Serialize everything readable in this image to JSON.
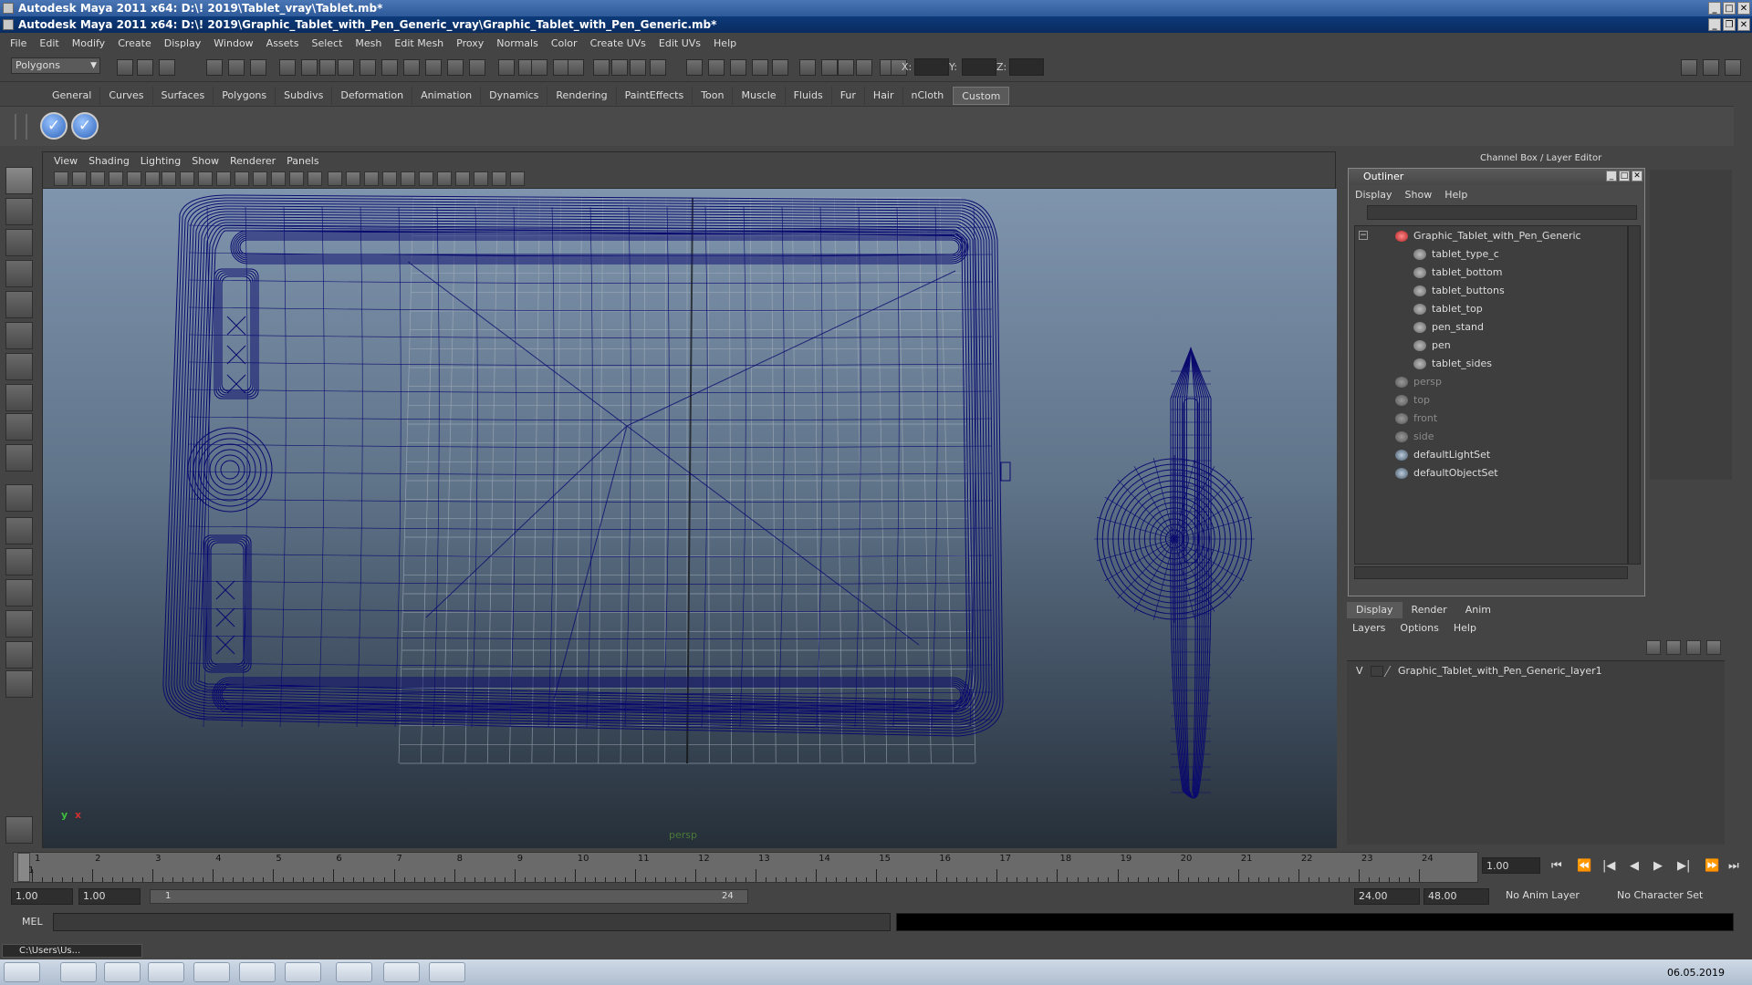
{
  "window": {
    "outer_title": "Autodesk Maya 2011 x64: D:\\! 2019\\Tablet_vray\\Tablet.mb*",
    "inner_title": "Autodesk Maya 2011 x64: D:\\! 2019\\Graphic_Tablet_with_Pen_Generic_vray\\Graphic_Tablet_with_Pen_Generic.mb*"
  },
  "menubar": [
    "File",
    "Edit",
    "Modify",
    "Create",
    "Display",
    "Window",
    "Assets",
    "Select",
    "Mesh",
    "Edit Mesh",
    "Proxy",
    "Normals",
    "Color",
    "Create UVs",
    "Edit UVs",
    "Help"
  ],
  "toolbar": {
    "mode": "Polygons",
    "x_label": "X:",
    "y_label": "Y:",
    "z_label": "Z:"
  },
  "shelf_tabs": [
    "General",
    "Curves",
    "Surfaces",
    "Polygons",
    "Subdivs",
    "Deformation",
    "Animation",
    "Dynamics",
    "Rendering",
    "PaintEffects",
    "Toon",
    "Muscle",
    "Fluids",
    "Fur",
    "Hair",
    "nCloth",
    "Custom"
  ],
  "shelf_active": "Custom",
  "viewport": {
    "menu": [
      "View",
      "Shading",
      "Lighting",
      "Show",
      "Renderer",
      "Panels"
    ],
    "camera": "persp",
    "axis_y": "y",
    "axis_x": "x",
    "wire_color": "#0a0a6e"
  },
  "right_panel": {
    "title": "Channel Box / Layer Editor"
  },
  "outliner": {
    "title": "Outliner",
    "menu": [
      "Display",
      "Show",
      "Help"
    ],
    "root": "Graphic_Tablet_with_Pen_Generic",
    "children": [
      "tablet_type_c",
      "tablet_bottom",
      "tablet_buttons",
      "tablet_top",
      "pen_stand",
      "pen",
      "tablet_sides"
    ],
    "cameras": [
      "persp",
      "top",
      "front",
      "side"
    ],
    "sets": [
      "defaultLightSet",
      "defaultObjectSet"
    ]
  },
  "layer_editor": {
    "tabs": [
      "Display",
      "Render",
      "Anim"
    ],
    "menu": [
      "Layers",
      "Options",
      "Help"
    ],
    "visibility": "V",
    "layer_name": "Graphic_Tablet_with_Pen_Generic_layer1"
  },
  "timeline": {
    "ticks": [
      "1",
      "2",
      "3",
      "4",
      "5",
      "6",
      "7",
      "8",
      "9",
      "10",
      "11",
      "12",
      "13",
      "14",
      "15",
      "16",
      "17",
      "18",
      "19",
      "20",
      "21",
      "22",
      "23",
      "24"
    ],
    "current_frame_marker": "1",
    "current_time": "1.00"
  },
  "range": {
    "start": "1.00",
    "playback_start": "1.00",
    "range_start_label": "1",
    "range_end_label": "24",
    "playback_end": "24.00",
    "end": "48.00",
    "anim_layer": "No Anim Layer",
    "character_set": "No Character Set"
  },
  "command": {
    "label": "MEL"
  },
  "minimized_window": "C:\\Users\\Us...",
  "taskbar": {
    "date": "06.05.2019"
  }
}
